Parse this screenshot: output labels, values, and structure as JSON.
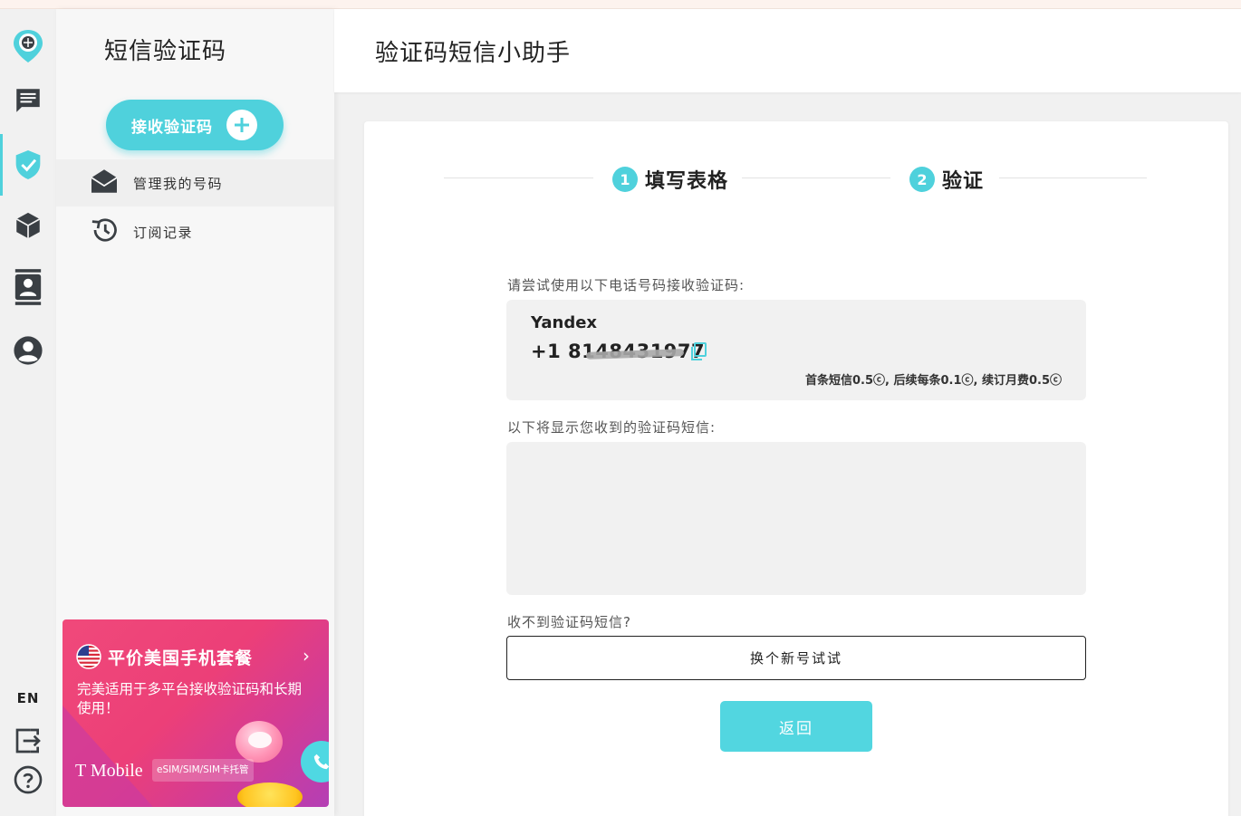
{
  "rail": {
    "icons": [
      "location-pin-logo-icon",
      "message-icon",
      "shield-check-icon",
      "box-icon",
      "contacts-icon",
      "account-icon"
    ],
    "language": "EN",
    "bottom_icons": [
      "logout-icon",
      "help-icon"
    ],
    "accent": "#4fd1dc"
  },
  "sidebar": {
    "title": "短信验证码",
    "receive_button": "接收验证码",
    "items": [
      {
        "label": "管理我的号码",
        "icon": "envelope-open-icon"
      },
      {
        "label": "订阅记录",
        "icon": "history-icon"
      }
    ]
  },
  "promo": {
    "title": "平价美国手机套餐",
    "description": "完美适用于多平台接收验证码和长期使用！",
    "brand": "T Mobile",
    "tag": "eSIM/SIM/SIM卡托管"
  },
  "header": {
    "title": "验证码短信小助手"
  },
  "steps": [
    {
      "number": "1",
      "label": "填写表格"
    },
    {
      "number": "2",
      "label": "验证"
    }
  ],
  "main": {
    "phone_prompt": "请尝试使用以下电话号码接收验证码:",
    "service": "Yandex",
    "phone_number": "+1 8148431977",
    "pricing": "首条短信0.5ⓒ, 后续每条0.1ⓒ, 续订月费0.5ⓒ",
    "sms_prompt": "以下将显示您收到的验证码短信:",
    "no_sms_prompt": "收不到验证码短信?",
    "try_new_button": "换个新号试试",
    "back_button": "返回"
  }
}
